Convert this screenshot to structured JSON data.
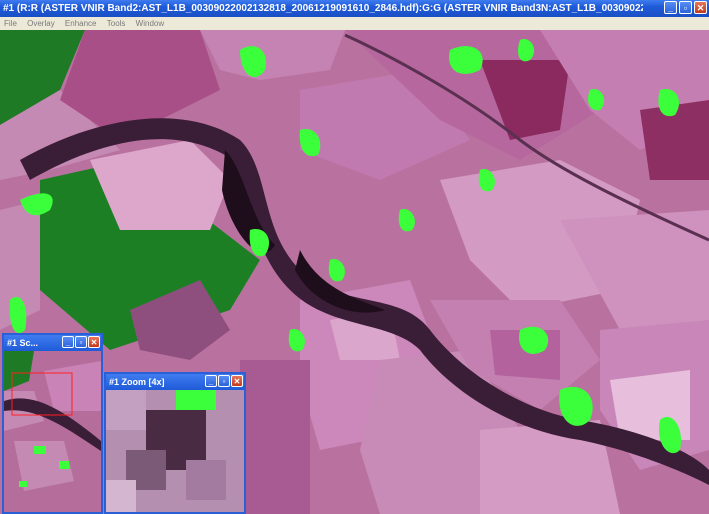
{
  "window": {
    "title": "#1 (R:R (ASTER VNIR Band2:AST_L1B_00309022002132818_20061219091610_2846.hdf):G:G (ASTER VNIR Band3N:AST_L1B_003090220021328..."
  },
  "menu": [
    "File",
    "Overlay",
    "Enhance",
    "Tools",
    "Window"
  ],
  "scroll_window": {
    "title": "#1 Sc..."
  },
  "zoom_window": {
    "title": "#1 Zoom [4x]"
  },
  "colors": {
    "titlebar": "#1f5bd8",
    "field_pink": "#c98ab8",
    "field_magenta": "#9c3f7a",
    "vegetation_green": "#1f8f2c",
    "bright_green": "#3cff3c",
    "river_dark": "#2a1426"
  }
}
